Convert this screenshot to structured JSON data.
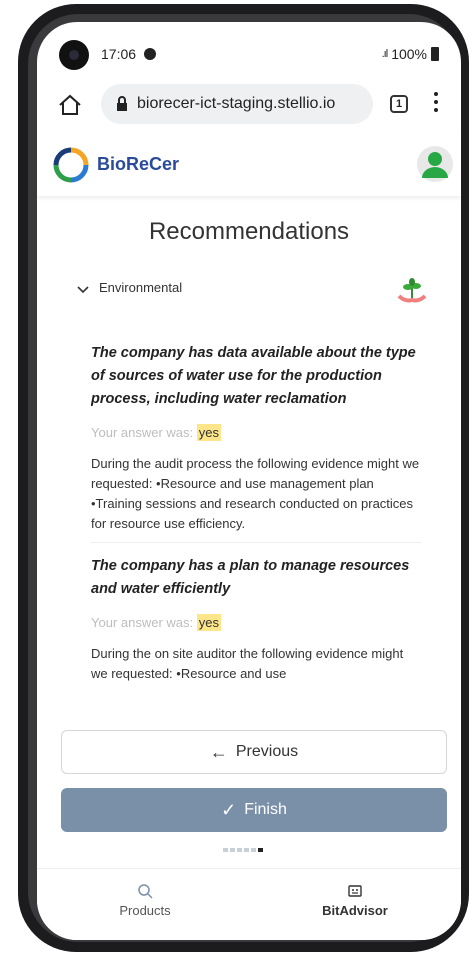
{
  "status_bar": {
    "time": "17:06",
    "battery": "100%"
  },
  "browser": {
    "url": "biorecer-ict-staging.stellio.io",
    "tab_count": "1"
  },
  "app": {
    "brand": "BioReCer"
  },
  "page": {
    "title": "Recommendations"
  },
  "section": {
    "label": "Environmental"
  },
  "recommendations": [
    {
      "question": "The company has data available about the type of sources of water use for the production process, including water reclamation",
      "answer_prefix": "Your answer was:",
      "answer": "yes",
      "evidence": "During the audit process the following evidence might we requested: •Resource and use management plan •Training sessions and research conducted on practices for resource use efficiency."
    },
    {
      "question": "The company has a plan to manage resources and water efficiently",
      "answer_prefix": "Your answer was:",
      "answer": "yes",
      "evidence": "During the on site auditor the following evidence might we requested: •Resource and use"
    }
  ],
  "buttons": {
    "previous": "Previous",
    "finish": "Finish"
  },
  "nav": {
    "products": "Products",
    "bitadvisor": "BitAdvisor"
  },
  "colors": {
    "brand": "#2a4b9b",
    "finish_button": "#7a90a9",
    "highlight": "#fde68a",
    "avatar": "#27a844"
  }
}
